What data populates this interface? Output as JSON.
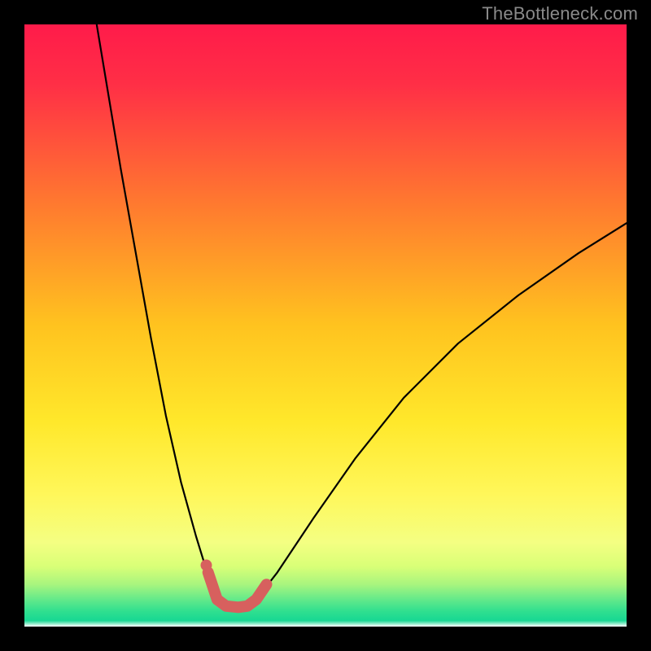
{
  "watermark": "TheBottleneck.com",
  "chart_data": {
    "type": "line",
    "title": "",
    "subtitle": "",
    "xlabel": "",
    "ylabel": "",
    "xlim": [
      0,
      100
    ],
    "ylim": [
      0,
      100
    ],
    "grid": false,
    "legend": false,
    "annotations": [],
    "colors": {
      "bg_black": "#000000",
      "gradient_top": "#ff1b4a",
      "gradient_mid": "#ffd400",
      "gradient_green_light": "#d9ff77",
      "gradient_green": "#2fdf8f",
      "gradient_white": "#ffffff",
      "curve": "#000000",
      "accent_highlight": "#d7605e"
    },
    "series": [
      {
        "name": "left-branch",
        "x": [
          12.0,
          14.0,
          16.0,
          18.5,
          21.0,
          23.5,
          26.0,
          28.5,
          30.5,
          32.0
        ],
        "y": [
          100.0,
          88.0,
          76.0,
          62.0,
          48.0,
          35.0,
          24.0,
          15.0,
          8.5,
          4.5
        ]
      },
      {
        "name": "right-branch",
        "x": [
          38.5,
          42.0,
          48.0,
          55.0,
          63.0,
          72.0,
          82.0,
          92.0,
          100.0
        ],
        "y": [
          4.5,
          9.0,
          18.0,
          28.0,
          38.0,
          47.0,
          55.0,
          62.0,
          67.0
        ]
      },
      {
        "name": "valley-floor",
        "x": [
          32.0,
          33.5,
          35.5,
          37.0,
          38.5
        ],
        "y": [
          4.5,
          3.4,
          3.2,
          3.4,
          4.5
        ]
      },
      {
        "name": "accent-highlight",
        "x": [
          30.5,
          32.0,
          33.5,
          35.5,
          37.0,
          38.5,
          40.2
        ],
        "y": [
          9.0,
          4.5,
          3.4,
          3.2,
          3.4,
          4.5,
          7.0
        ]
      },
      {
        "name": "accent-dot",
        "x": [
          30.2
        ],
        "y": [
          10.2
        ]
      }
    ]
  }
}
